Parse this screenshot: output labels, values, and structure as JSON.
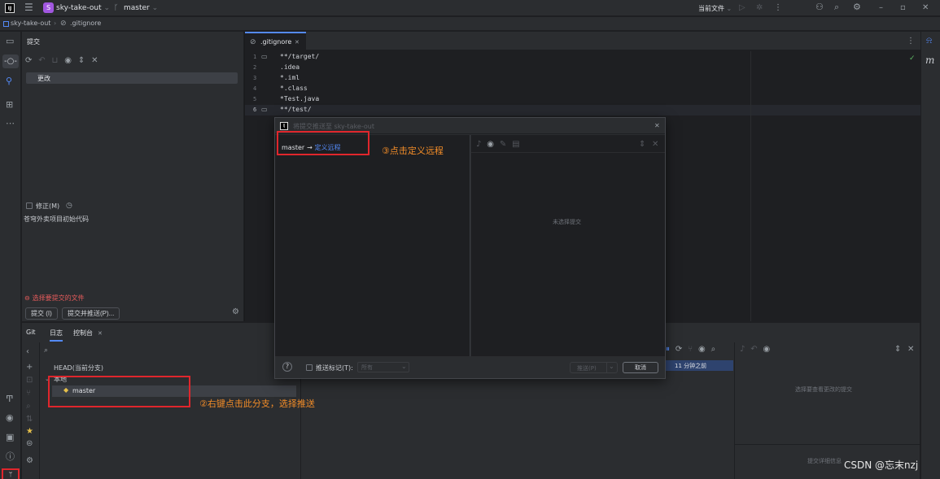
{
  "titlebar": {
    "app_logo": "IJ",
    "project_badge": "S",
    "project_name": "sky-take-out",
    "branch_name": "master",
    "run_config": "当前文件",
    "window_min": "–",
    "window_max": "▫",
    "window_close": "✕"
  },
  "breadcrumb": {
    "project": "sky-take-out",
    "file": ".gitignore"
  },
  "commit_panel": {
    "title": "提交",
    "changes_group": "更改",
    "amend_label": "修正(M)",
    "message": "苍穹外卖项目初始代码",
    "warning": "选择要提交的文件",
    "commit_button": "提交 (I)",
    "commit_push_button": "提交并推送(P)..."
  },
  "editor": {
    "tab_name": ".gitignore",
    "lines": [
      {
        "num": "1",
        "text": "**/target/"
      },
      {
        "num": "2",
        "text": ".idea"
      },
      {
        "num": "3",
        "text": "*.iml"
      },
      {
        "num": "4",
        "text": "*.class"
      },
      {
        "num": "5",
        "text": "*Test.java"
      },
      {
        "num": "6",
        "text": "**/test/"
      }
    ]
  },
  "push_dialog": {
    "title": "将提交推送至 sky-take-out",
    "branch_local": "master",
    "arrow": "→",
    "remote_link": "定义远程",
    "empty_message": "未选择提交",
    "push_tags_label": "推送标记(T):",
    "push_tags_value": "所有",
    "push_button": "推送(P)",
    "cancel_button": "取消",
    "help": "?"
  },
  "bottom_panel": {
    "tabs": [
      "Git",
      "日志",
      "控制台"
    ],
    "search_placeholder": "Q",
    "head_label": "HEAD(当前分支)",
    "local_group": "本地",
    "branch_item": "master",
    "commit_time": "11 分钟之前",
    "details_empty": "选择要查看更改的提交",
    "details_footer": "提交详细信息"
  },
  "annotations": {
    "step2": "②右键点击此分支，选择推送",
    "step3": "③点击定义远程"
  },
  "watermark": "CSDN @忘末nzj",
  "colors": {
    "accent_link": "#548af7",
    "annotation_red": "#e0262c",
    "annotation_orange": "#f28c28",
    "project_badge": "#a157e0",
    "warning_red": "#e55b5b",
    "check_green": "#5fb865"
  }
}
